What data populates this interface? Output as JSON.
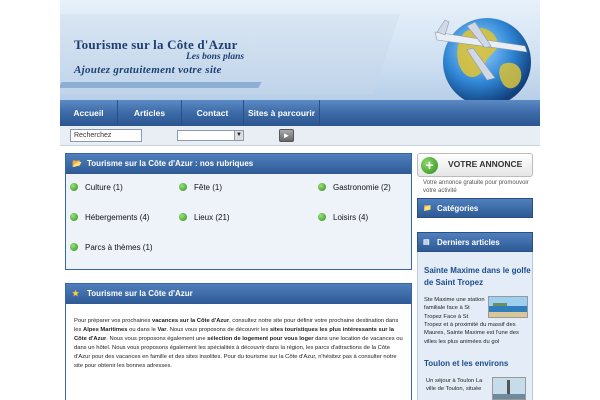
{
  "header": {
    "title": "Tourisme sur la Côte d'Azur",
    "tagline1": "Les bons plans",
    "tagline2": "Ajoutez gratuitement votre site"
  },
  "nav": {
    "items": [
      {
        "label": "Accueil"
      },
      {
        "label": "Articles"
      },
      {
        "label": "Contact"
      },
      {
        "label": "Sites à parcourir"
      }
    ]
  },
  "search": {
    "input_value": "Recherchez",
    "select_value": "",
    "go_icon": "arrow-right-icon"
  },
  "rubriques": {
    "heading": "Tourisme sur la Côte d'Azur : nos rubriques",
    "items": [
      {
        "label": "Culture (1)"
      },
      {
        "label": "Fête (1)"
      },
      {
        "label": "Gastronomie (2)"
      },
      {
        "label": "Hébergements (4)"
      },
      {
        "label": "Lieux (21)"
      },
      {
        "label": "Loisirs (4)"
      },
      {
        "label": "Parcs à thèmes (1)"
      }
    ]
  },
  "intro": {
    "heading": "Tourisme sur la Côte d'Azur",
    "p1": "Pour préparer vos prochaines ",
    "b1": "vacances sur la Côte d'Azur",
    "p2": ", consultez notre site pour définir votre prochaine destination dans les ",
    "b2": "Alpes Maritimes",
    "p3": " ou dans le ",
    "b3": "Var",
    "p4": ". Nous vous proposons de découvrir les ",
    "b4": "sites touristiques les plus intéressants sur la Côte d'Azur",
    "p5": ". Nous vous proposons également une ",
    "b5": "sélection de logement pour vous loger",
    "p6": " dans une location de vacances ou dans un hôtel. Nous vous proposons également les spécialités à découvrir dans la région, les parcs d'attractions de la Côte d'Azur pour des vacances en famille et des sites insolites. Pour du tourisme sur la Côte d'Azur, n'hésitez pas à consulter notre site pour obtenir les bonnes adresses."
  },
  "sidebar": {
    "annonce_label": "VOTRE ANNONCE",
    "annonce_sub": "Votre annonce gratuite pour promouvoir votre activité",
    "categories_heading": "Catégories",
    "derniers_heading": "Derniers articles",
    "articles": [
      {
        "title": "Sainte Maxime dans le golfe de Saint Tropez",
        "text_wrap": "Ste Maxime une station familiale face à St Tropez Face à St",
        "text_full": "Tropez et à proximité du massif des Maures, Sainte Maxime est l'une des villes les plus animées du gol"
      },
      {
        "title": "Toulon et les environs",
        "text_wrap": "Un séjour à Toulon La ville de Toulon, située"
      }
    ]
  },
  "colors": {
    "nav_blue": "#3c6aa8",
    "box_head_blue": "#2e5a95",
    "bullet_green": "#2f8f1e",
    "title_navy": "#1e3f72"
  }
}
